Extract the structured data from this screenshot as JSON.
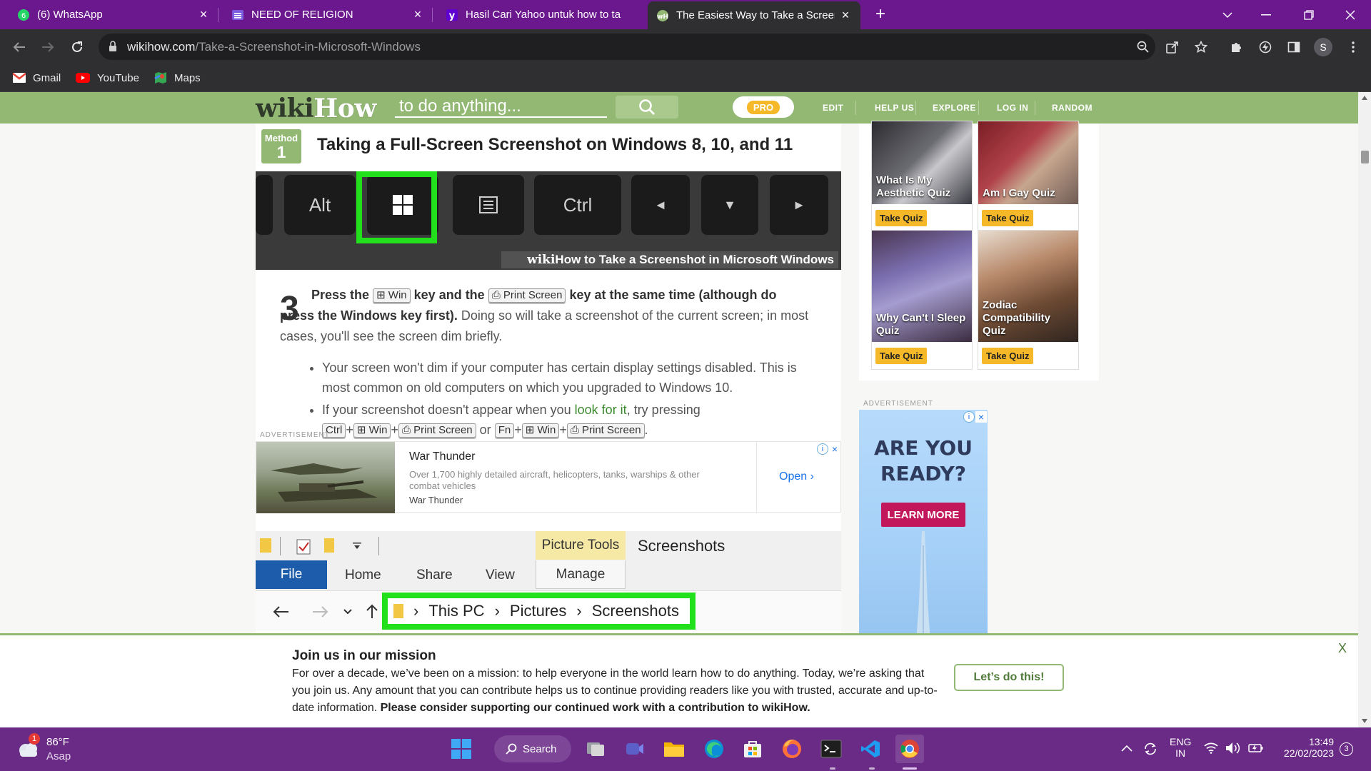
{
  "browser": {
    "tabs": [
      {
        "title": "(6) WhatsApp",
        "icon": "whatsapp-icon",
        "active": false
      },
      {
        "title": "NEED OF RELIGION",
        "icon": "doc-list-icon",
        "active": false
      },
      {
        "title": "Hasil Cari Yahoo untuk how to ta",
        "icon": "yahoo-icon",
        "active": false
      },
      {
        "title": "The Easiest Way to Take a Screen",
        "icon": "wikihow-icon",
        "active": true
      }
    ],
    "url_host": "wikihow.com",
    "url_path": "/Take-a-Screenshot-in-Microsoft-Windows",
    "profile_initial": "S",
    "bookmarks": [
      {
        "label": "Gmail",
        "icon": "gmail-icon"
      },
      {
        "label": "YouTube",
        "icon": "youtube-icon"
      },
      {
        "label": "Maps",
        "icon": "maps-icon"
      }
    ]
  },
  "wikihow": {
    "logo_wiki": "wiki",
    "logo_how": "How",
    "search_placeholder": "to do anything...",
    "pro_label": "PRO",
    "nav": [
      "EDIT",
      "HELP US",
      "EXPLORE",
      "LOG IN",
      "RANDOM"
    ]
  },
  "article": {
    "method_label": "Method",
    "method_number": "1",
    "method_title": "Taking a Full-Screen Screenshot on Windows 8, 10, and 11",
    "keyboard_keys": [
      "Alt",
      "",
      "",
      "Ctrl",
      "◄",
      "▼",
      "►"
    ],
    "watermark_wiki": "wiki",
    "watermark_rest": "How to Take a Screenshot in Microsoft Windows",
    "step_number": "3",
    "step_bold_1": "Press the",
    "kbd_win": "⊞ Win",
    "step_bold_2": "key and the",
    "kbd_print": "⎙ Print Screen",
    "step_bold_3": "key at the same time (although do press the Windows key first).",
    "step_rest": " Doing so will take a screenshot of the current screen; in most cases, you'll see the screen dim briefly.",
    "bullet_1": "Your screen won't dim if your computer has certain display settings disabled. This is most common on old computers on which you upgraded to Windows 10.",
    "bullet_2_pre": "If your screenshot doesn't appear when you ",
    "bullet_2_link": "look for it",
    "bullet_2_post": ", try pressing",
    "kbd_ctrl": "Ctrl",
    "kbd_fn": "Fn",
    "plus": "+",
    "or": "or",
    "period": "."
  },
  "ad_war_thunder": {
    "label": "ADVERTISEMENT",
    "title": "War Thunder",
    "desc": "Over 1,700 highly detailed aircraft, helicopters, tanks, warships & other combat vehicles",
    "advertiser": "War Thunder",
    "open": "Open"
  },
  "explorer": {
    "picture_tools": "Picture Tools",
    "window_title": "Screenshots",
    "tabs": [
      "File",
      "Home",
      "Share",
      "View",
      "Manage"
    ],
    "path": [
      "This PC",
      "Pictures",
      "Screenshots"
    ]
  },
  "sidebar": {
    "quizzes": [
      {
        "title": "What Is My Aesthetic Quiz",
        "button": "Take Quiz"
      },
      {
        "title": "Am I Gay Quiz",
        "button": "Take Quiz"
      },
      {
        "title": "Why Can't I Sleep Quiz",
        "button": "Take Quiz"
      },
      {
        "title": "Zodiac Compatibility Quiz",
        "button": "Take Quiz"
      }
    ],
    "ad_label": "ADVERTISEMENT",
    "ad_headline": "ARE YOU READY?",
    "ad_button": "LEARN MORE"
  },
  "banner": {
    "title": "Join us in our mission",
    "body": "For over a decade, we’ve been on a mission: to help everyone in the world learn how to do anything. Today, we’re asking that you join us. Any amount that you can contribute helps us to continue providing readers like you with trusted, accurate and up-to-date information. ",
    "body_bold": "Please consider supporting our continued work with a contribution to wikiHow.",
    "button": "Let’s do this!",
    "close": "X"
  },
  "taskbar": {
    "weather_temp": "86°F",
    "weather_desc": "Asap",
    "weather_badge": "1",
    "search_label": "Search",
    "lang_1": "ENG",
    "lang_2": "IN",
    "time": "13:49",
    "date": "22/02/2023",
    "notif_count": "3"
  }
}
